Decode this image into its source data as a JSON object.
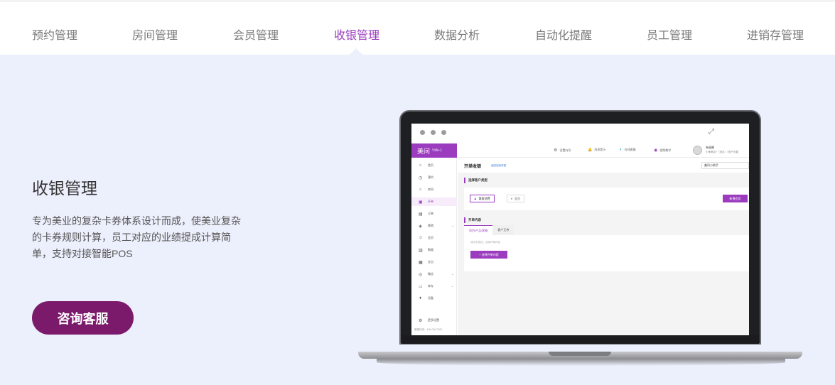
{
  "tabs": [
    {
      "label": "预约管理",
      "active": false
    },
    {
      "label": "房间管理",
      "active": false
    },
    {
      "label": "会员管理",
      "active": false
    },
    {
      "label": "收银管理",
      "active": true
    },
    {
      "label": "数据分析",
      "active": false
    },
    {
      "label": "自动化提醒",
      "active": false
    },
    {
      "label": "员工管理",
      "active": false
    },
    {
      "label": "进销存管理",
      "active": false
    }
  ],
  "hero": {
    "title": "收银管理",
    "description": "专为美业的复杂卡券体系设计而成，使美业复杂的卡券规则计算，员工对应的业绩提成计算简单，支持对接智能POS",
    "cta_label": "咨询客服"
  },
  "colors": {
    "accent": "#9b3cbf",
    "cta": "#7b1a6b",
    "background": "#eceffc"
  },
  "screen": {
    "brand": "美问",
    "brand_sub": "Vtiki-1",
    "topbar": [
      {
        "icon": "gear-icon",
        "glyph": "⚙",
        "label": "设置向导"
      },
      {
        "icon": "bell-icon",
        "glyph": "🔔",
        "label": "消息提示"
      },
      {
        "icon": "headset-icon",
        "glyph": "◐",
        "label": "在线客服"
      },
      {
        "icon": "video-icon",
        "glyph": "◉",
        "label": "视频教学"
      }
    ],
    "user_name": "朱丽娜",
    "user_sub": "小美美容+（测试）/ 账户设置",
    "sidebar": [
      {
        "label": "首页",
        "glyph": "⌂",
        "icon": "home-icon",
        "active": false,
        "arrow": false
      },
      {
        "label": "预约",
        "glyph": "◷",
        "icon": "clock-icon",
        "active": false,
        "arrow": false
      },
      {
        "label": "房间",
        "glyph": "⌂",
        "icon": "room-icon",
        "active": false,
        "arrow": false
      },
      {
        "label": "开单",
        "glyph": "▣",
        "icon": "order-icon",
        "active": true,
        "arrow": false
      },
      {
        "label": "订单",
        "glyph": "▤",
        "icon": "list-icon",
        "active": false,
        "arrow": false
      },
      {
        "label": "营销",
        "glyph": "◈",
        "icon": "marketing-icon",
        "active": false,
        "arrow": true
      },
      {
        "label": "会员",
        "glyph": "☺",
        "icon": "member-icon",
        "active": false,
        "arrow": false
      },
      {
        "label": "数据",
        "glyph": "▥",
        "icon": "chart-icon",
        "active": false,
        "arrow": false
      },
      {
        "label": "支出",
        "glyph": "▦",
        "icon": "expense-icon",
        "active": false,
        "arrow": false
      },
      {
        "label": "微信",
        "glyph": "◎",
        "icon": "wechat-icon",
        "active": false,
        "arrow": true
      },
      {
        "label": "库存",
        "glyph": "▭",
        "icon": "inventory-icon",
        "active": false,
        "arrow": true
      },
      {
        "label": "设备",
        "glyph": "♦",
        "icon": "device-icon",
        "active": false,
        "arrow": false
      },
      {
        "label": "更多设置",
        "glyph": "⚙",
        "icon": "settings-icon",
        "active": false,
        "arrow": false
      }
    ],
    "sidebar_footer": "客服热线：400-000-2020",
    "page_title": "开单收银",
    "page_link": "返回旧版收银",
    "assistant": "美问小助手",
    "section1": "选择客户类型",
    "customer_types": [
      {
        "label": "散客消费",
        "selected": true
      },
      {
        "label": "会员",
        "selected": false
      }
    ],
    "new_member": "新增会员",
    "section2": "开单内容",
    "content_tabs": [
      {
        "label": "项目/产品/套餐",
        "active": true
      },
      {
        "label": "客户互券",
        "active": false
      }
    ],
    "hint": "请点击按钮，选择开单内容",
    "add_item": "+ 选择开单内容"
  }
}
